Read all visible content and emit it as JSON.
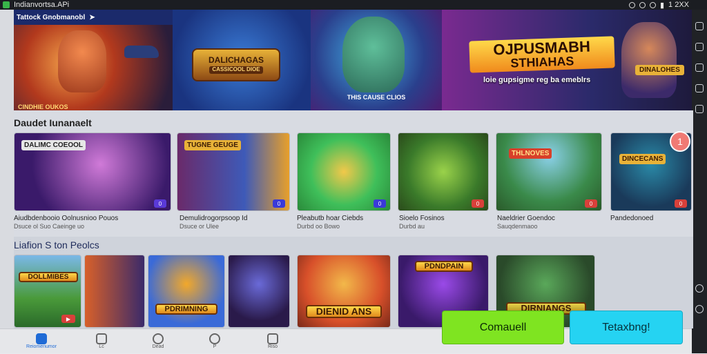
{
  "status_bar": {
    "title": "Indianvortsa.APi",
    "time": "1 2XX"
  },
  "hero": {
    "topbar_label": "Tattock Gnobmanobl",
    "panel_a_caption": "CINDHIE OUKOS",
    "logo_a_line1": "DALICHAGAS",
    "logo_a_line2": "CASSICOOL DIOE",
    "center_caption": "THIS CAUSE CLIOS",
    "title_line1": "OJPUSMABH",
    "title_line2": "STHIAHAS",
    "subtitle": "loie gupsigme reg ba emeblrs",
    "badge": "DINALOHES"
  },
  "section_featured": {
    "title": "Daudet Iunanaelt",
    "notification_count": "1",
    "cards": [
      {
        "logo": "DALIMC COEOOL",
        "label": "Aiudbdenbooio Oolnusnioo Pouos",
        "sub": "Dsuce  ol  Suo  Caeinge  uo",
        "badge": "0"
      },
      {
        "logo": "TUGNE GEUGE",
        "label": "Demulidrogorpsoop Id",
        "sub": "Dsuce  or  Ulee",
        "badge": "0"
      },
      {
        "logo": "",
        "label": "Pleabutb hoar  Ciebds",
        "sub": "Durbd  oo  Bowo",
        "badge": "0"
      },
      {
        "logo": "",
        "label": "Sioelo Fosinos",
        "sub": "Durbd  au",
        "badge": "0"
      },
      {
        "logo": "THLNOVES",
        "label": "Naeldrier Goendoc",
        "sub": "Sauqdenmaoo",
        "badge": "0"
      },
      {
        "logo": "DINCECANS",
        "label": "Pandedonoed",
        "sub": "",
        "badge": "0"
      }
    ]
  },
  "section_popular": {
    "title": "Liafion S ton Peolcs",
    "cards": [
      {
        "logo": "DOLLMIBES"
      },
      {
        "logo": ""
      },
      {
        "logo": "PDRIMNING"
      },
      {
        "logo": ""
      },
      {
        "logo": "DIENID ANS"
      },
      {
        "logo": "PDNDPAIN"
      },
      {
        "logo": "DIRNIANGS"
      }
    ]
  },
  "bottom_nav": {
    "items": [
      {
        "label": "Reiomenumor"
      },
      {
        "label": "Lc"
      },
      {
        "label": "Dead"
      },
      {
        "label": "P"
      },
      {
        "label": "Riso"
      }
    ]
  },
  "actions": {
    "primary_label": "Comauell",
    "secondary_label": "Tetaxbng!"
  }
}
